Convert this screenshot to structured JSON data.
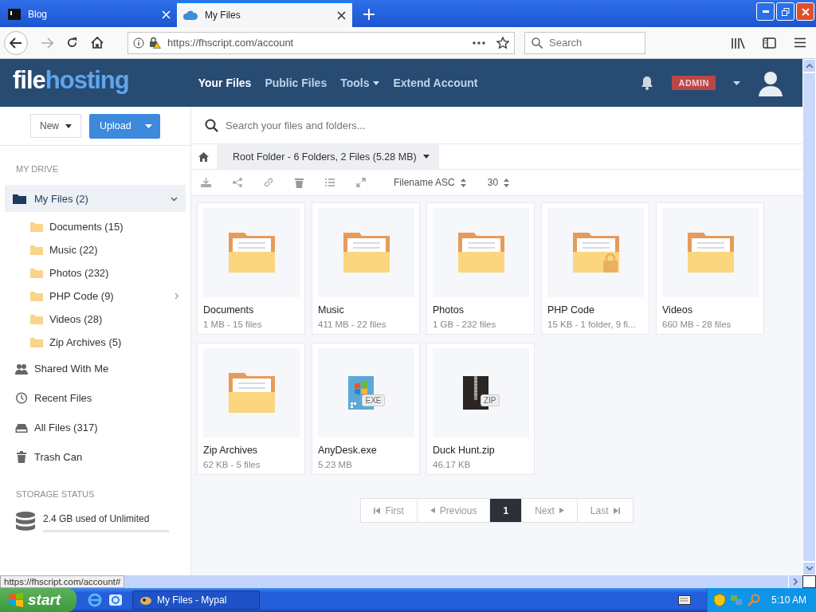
{
  "browser": {
    "tabs": [
      {
        "title": "Blog",
        "selected": false
      },
      {
        "title": "My Files",
        "selected": true
      }
    ],
    "url": "https://fhscript.com/account",
    "search_placeholder": "Search"
  },
  "header": {
    "logo": {
      "text_1": "file",
      "text_2": "hosting"
    },
    "nav": [
      {
        "label": "Your Files",
        "selected": true,
        "dropdown": false
      },
      {
        "label": "Public Files",
        "selected": false,
        "dropdown": false
      },
      {
        "label": "Tools",
        "selected": false,
        "dropdown": true
      },
      {
        "label": "Extend Account",
        "selected": false,
        "dropdown": false
      }
    ],
    "badge": "ADMIN"
  },
  "sidebar": {
    "new_button": "New",
    "upload_button": "Upload",
    "section": "MY DRIVE",
    "my_files": {
      "label": "My Files (2)",
      "selected": true,
      "expanded": true,
      "children": [
        {
          "label": "Documents (15)",
          "has_children": false
        },
        {
          "label": "Music (22)",
          "has_children": false
        },
        {
          "label": "Photos (232)",
          "has_children": false
        },
        {
          "label": "PHP Code (9)",
          "has_children": true
        },
        {
          "label": "Videos (28)",
          "has_children": false
        },
        {
          "label": "Zip Archives (5)",
          "has_children": false
        }
      ]
    },
    "links": [
      {
        "label": "Shared With Me"
      },
      {
        "label": "Recent Files"
      },
      {
        "label": "All Files (317)"
      },
      {
        "label": "Trash Can"
      }
    ],
    "storage": {
      "title": "STORAGE STATUS",
      "text": "2.4 GB used of Unlimited",
      "level": 0
    }
  },
  "main": {
    "search_placeholder": "Search your files and folders...",
    "breadcrumb": "Root Folder - 6 Folders, 2 Files (5.28 MB)",
    "sort": "Filename ASC",
    "per_page": "30",
    "items": [
      {
        "kind": "folder",
        "name": "Documents",
        "meta": "1 MB - 15 files"
      },
      {
        "kind": "folder",
        "name": "Music",
        "meta": "411 MB - 22 files"
      },
      {
        "kind": "folder",
        "name": "Photos",
        "meta": "1 GB - 232 files"
      },
      {
        "kind": "locked",
        "name": "PHP Code",
        "meta": "15 KB - 1 folder, 9 fi..."
      },
      {
        "kind": "folder",
        "name": "Videos",
        "meta": "660 MB - 28 files"
      },
      {
        "kind": "folder",
        "name": "Zip Archives",
        "meta": "62 KB - 5 files"
      },
      {
        "kind": "exe",
        "name": "AnyDesk.exe",
        "meta": "5.23 MB",
        "badge": "EXE"
      },
      {
        "kind": "zip",
        "name": "Duck Hunt.zip",
        "meta": "46.17 KB",
        "badge": "ZIP"
      }
    ],
    "pagination": [
      {
        "kind": "first",
        "label": "First",
        "selected": false
      },
      {
        "kind": "prev",
        "label": "Previous",
        "selected": false
      },
      {
        "kind": "page",
        "label": "1",
        "selected": true
      },
      {
        "kind": "next",
        "label": "Next",
        "selected": false
      },
      {
        "kind": "last",
        "label": "Last",
        "selected": false
      }
    ]
  },
  "status_url": "https://fhscript.com/account#",
  "taskbar": {
    "start": "start",
    "task": "My Files - Mypal",
    "clock": "5:10 AM"
  }
}
